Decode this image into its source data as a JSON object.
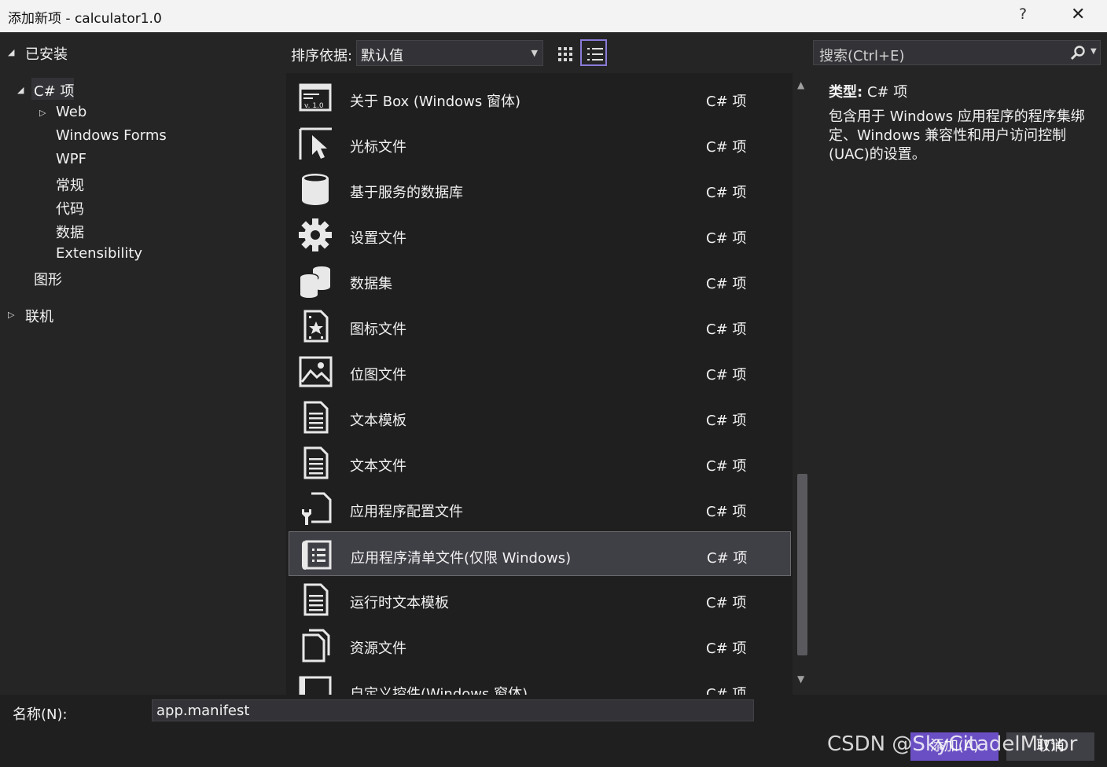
{
  "window": {
    "title": "添加新项 - calculator1.0",
    "help": "?",
    "close": "✕"
  },
  "tree": {
    "installed": "已安装",
    "csharp": "C# 项",
    "web": "Web",
    "winforms": "Windows Forms",
    "wpf": "WPF",
    "general": "常规",
    "code": "代码",
    "data": "数据",
    "extensibility": "Extensibility",
    "graphics": "图形",
    "online": "联机"
  },
  "toolbar": {
    "sort_label": "排序依据:",
    "sort_value": "默认值"
  },
  "items": [
    {
      "name": "关于 Box (Windows 窗体)",
      "type": "C# 项",
      "icon": "about-box-icon"
    },
    {
      "name": "光标文件",
      "type": "C# 项",
      "icon": "cursor-icon"
    },
    {
      "name": "基于服务的数据库",
      "type": "C# 项",
      "icon": "database-icon"
    },
    {
      "name": "设置文件",
      "type": "C# 项",
      "icon": "gear-icon"
    },
    {
      "name": "数据集",
      "type": "C# 项",
      "icon": "dataset-icon"
    },
    {
      "name": "图标文件",
      "type": "C# 项",
      "icon": "icon-file-icon"
    },
    {
      "name": "位图文件",
      "type": "C# 项",
      "icon": "bitmap-icon"
    },
    {
      "name": "文本模板",
      "type": "C# 项",
      "icon": "text-template-icon"
    },
    {
      "name": "文本文件",
      "type": "C# 项",
      "icon": "text-file-icon"
    },
    {
      "name": "应用程序配置文件",
      "type": "C# 项",
      "icon": "config-file-icon"
    },
    {
      "name": "应用程序清单文件(仅限 Windows)",
      "type": "C# 项",
      "icon": "manifest-icon"
    },
    {
      "name": "运行时文本模板",
      "type": "C# 项",
      "icon": "runtime-template-icon"
    },
    {
      "name": "资源文件",
      "type": "C# 项",
      "icon": "resource-file-icon"
    },
    {
      "name": "自定义控件(Windows 窗体)",
      "type": "C# 项",
      "icon": "custom-control-icon"
    }
  ],
  "selected_index": 10,
  "details": {
    "type_label": "类型:",
    "type_value": "C# 项",
    "description": "包含用于 Windows 应用程序的程序集绑定、Windows 兼容性和用户访问控制(UAC)的设置。"
  },
  "search": {
    "placeholder": "搜索(Ctrl+E)"
  },
  "bottom": {
    "name_label": "名称(N):",
    "name_value": "app.manifest",
    "add_label": "添加(A)",
    "cancel_label": "取消",
    "watermark": "CSDN @SkyCitadelMinor"
  },
  "colors": {
    "accent": "#6a4fc4",
    "background": "#1f1f1f",
    "panel": "#252526",
    "selection": "#3f3f46"
  }
}
